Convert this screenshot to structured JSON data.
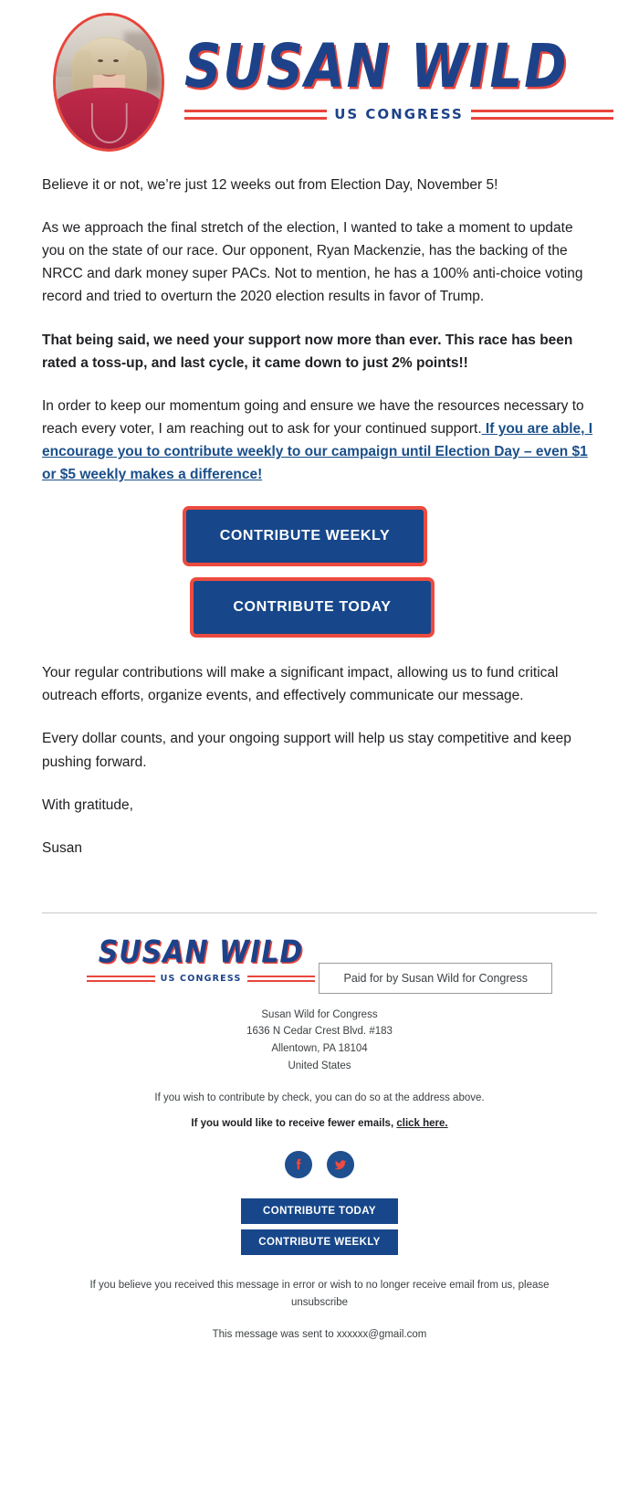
{
  "header": {
    "portrait_alt": "Susan Wild portrait",
    "logo": {
      "name": "SUSAN WILD",
      "subtitle": "US CONGRESS"
    },
    "colors": {
      "navy": "#1d4289",
      "red": "#e8453c"
    }
  },
  "body": {
    "p1": "Believe it or not, we’re just 12 weeks out from Election Day, November 5!",
    "p2": "As we approach the final stretch of the election, I wanted to take a moment to update you on the state of our race. Our opponent, Ryan Mackenzie, has the backing of the NRCC and dark money super PACs. Not to mention, he has a 100% anti-choice voting record and tried to overturn the 2020 election results in favor of Trump.",
    "p3_bold": "That being said, we need your support now more than ever. This race has been rated a toss-up, and last cycle, it came down to just 2% points!!",
    "p4_lead": "In order to keep our momentum going and ensure we have the resources necessary to reach every voter, I am reaching out to ask for your continued support.",
    "p4_link": " If you are able, I encourage you to contribute weekly to our campaign until Election Day – even $1 or $5 weekly makes a difference!",
    "p5": "Your regular contributions will make a significant impact, allowing us to fund critical outreach efforts, organize events, and effectively communicate our message.",
    "p6": "Every dollar counts, and your ongoing support will help us stay competitive and keep pushing forward.",
    "signoff": "With gratitude,",
    "signature": "Susan"
  },
  "cta": {
    "weekly": "CONTRIBUTE WEEKLY",
    "today": "CONTRIBUTE TODAY",
    "bg": "#17478a",
    "border": "#ec4b3f"
  },
  "footer": {
    "logo": {
      "name": "SUSAN WILD",
      "subtitle": "US CONGRESS"
    },
    "paid_for": "Paid for by Susan Wild for Congress",
    "address": {
      "org": "Susan Wild for Congress",
      "street": "1636 N Cedar Crest Blvd. #183",
      "city_state_zip": "Allentown, PA 18104",
      "country": "United States"
    },
    "check_note": "If you wish to contribute by check, you can do so at the address above.",
    "fewer_emails_text": "If you would like to receive fewer emails,",
    "fewer_emails_link": "click here.",
    "social": [
      {
        "name": "facebook-icon",
        "label": "Facebook"
      },
      {
        "name": "twitter-icon",
        "label": "Twitter"
      }
    ],
    "buttons": {
      "today": "CONTRIBUTE TODAY",
      "weekly": "CONTRIBUTE WEEKLY"
    },
    "legal_text": "If you believe you received this message in error or wish to no longer receive email from us, please",
    "legal_link": "unsubscribe",
    "sent_to": "This message was sent to xxxxxx@gmail.com"
  }
}
